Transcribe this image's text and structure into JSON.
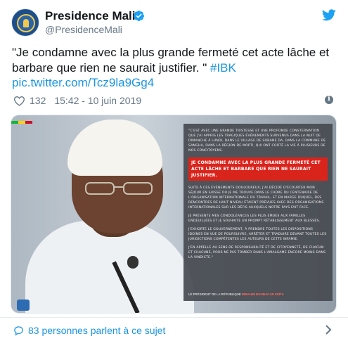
{
  "account": {
    "display_name": "Presidence Mali",
    "handle": "@PresidenceMali",
    "verified_icon": "verified-badge-icon",
    "avatar_icon": "coat-of-arms-icon"
  },
  "tweet": {
    "text": "\"Je condamne avec la plus grande fermeté cet acte lâche et barbare que rien ne saurait justifier. \"",
    "hashtag": "#IBK",
    "link": "pic.twitter.com/Tcz9la9Gg4"
  },
  "meta": {
    "likes": "132",
    "timestamp": "15:42 - 10 juin 2019",
    "like_icon": "heart-icon",
    "info_icon": "info-icon"
  },
  "media": {
    "statement_intro": "\"C'est avec une grande tristesse et une profonde consternation que j'ai appris les tragiques événements survenus dans la nuit de dimanche à lundi, dans le village de Sobane Da, dans la commune de Sangha, dans la région de Mopti, qui ont coûté la vie à plusieurs de nos concitoyens.",
    "statement_highlight": "Je condamne avec la plus grande fermeté cet acte lâche et barbare que rien ne saurait justifier.",
    "statement_p1": "Suite à ces événements douloureux, j'ai décidé d'écourter mon séjour en Suisse où je me trouve dans le cadre du centenaire de l'Organisation Internationale du Travail, et en marge duquel, des rencontres de haut niveau étaient prévues avec des organisations internationales sur les défis auxquels notre pays fait face.",
    "statement_p2": "Je présente mes condoléances les plus émues aux familles endeuillées et je souhaite un prompt rétablissement aux blessés.",
    "statement_p3": "J'exhorte le gouvernement, à prendre toutes les dispositions idoines en vue de poursuivre, arrêter et traduire devant toutes les juridictions compétentes les auteurs de cette infamie.",
    "statement_p4": "J'en appelle au sens de responsabilité et de citoyenneté, de chacun et chacune, pour ne pas tomber dans l'amalgame encore moins dans la vindicte.\"",
    "signature_prefix": "Le président de la république",
    "signature_name": "Ibrahim Boubacar Keïta",
    "flag_colors": [
      "#14b53a",
      "#fcd116",
      "#ce1126"
    ]
  },
  "footer": {
    "text": "83 personnes parlent à ce sujet",
    "icon": "speech-bubble-icon"
  },
  "colors": {
    "twitter_blue": "#1b95e0",
    "highlight_red": "#d9241c"
  }
}
